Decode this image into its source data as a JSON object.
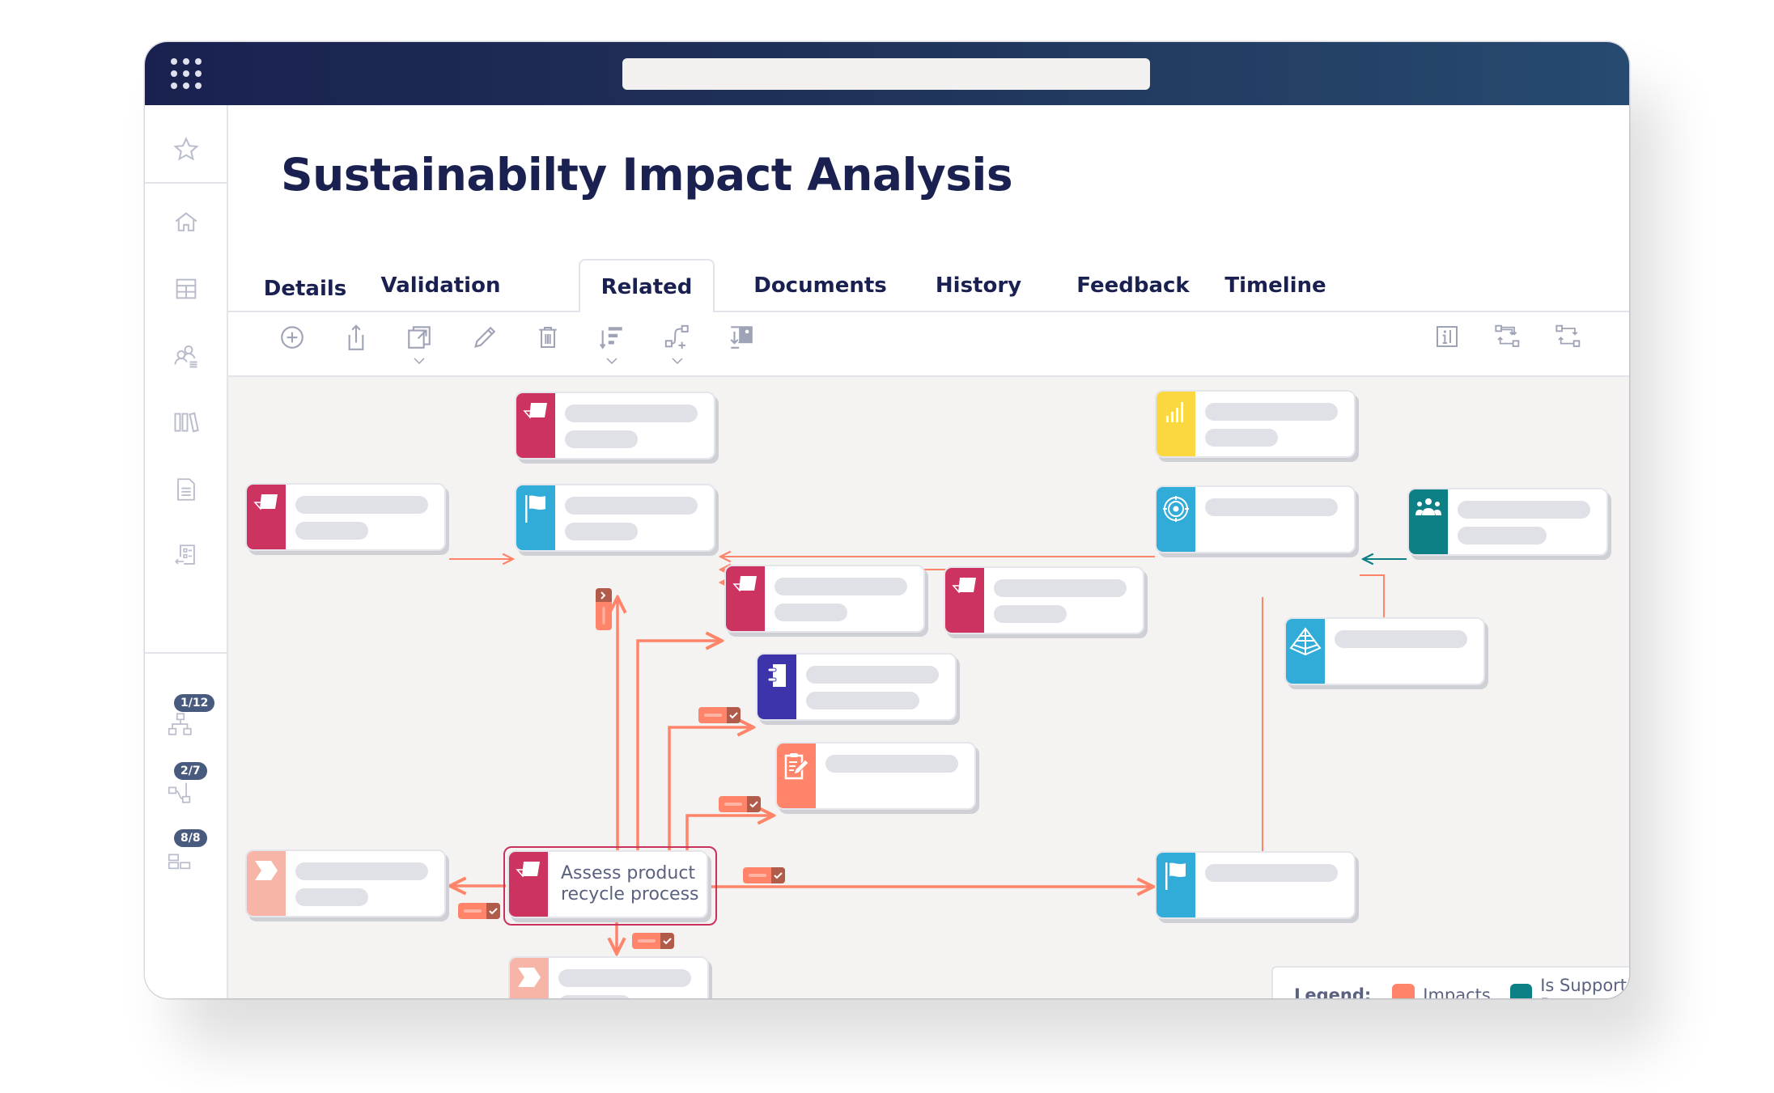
{
  "app": {
    "search": {
      "value": "",
      "placeholder": ""
    }
  },
  "sidebar": {
    "items": [
      {
        "name": "favorites",
        "icon": "star-icon"
      },
      {
        "name": "home",
        "icon": "home-icon"
      },
      {
        "name": "table",
        "icon": "table-icon"
      },
      {
        "name": "users",
        "icon": "users-icon"
      },
      {
        "name": "library",
        "icon": "library-icon"
      },
      {
        "name": "document",
        "icon": "document-icon"
      },
      {
        "name": "checklist",
        "icon": "checklist-icon"
      }
    ],
    "views": [
      {
        "name": "hierarchy-view",
        "icon": "hierarchy-icon",
        "badge": "1/12"
      },
      {
        "name": "flow-view",
        "icon": "flow-icon",
        "badge": "2/7"
      },
      {
        "name": "grid-view",
        "icon": "grid-icon",
        "badge": "8/8"
      }
    ]
  },
  "page": {
    "title": "Sustainabilty Impact Analysis"
  },
  "tabs": [
    {
      "label": "Details",
      "active": false
    },
    {
      "label": "Validation",
      "active": false
    },
    {
      "label": "Related",
      "active": true
    },
    {
      "label": "Documents",
      "active": false
    },
    {
      "label": "History",
      "active": false
    },
    {
      "label": "Feedback",
      "active": false
    },
    {
      "label": "Timeline",
      "active": false
    }
  ],
  "toolbar": {
    "left": [
      "add-icon",
      "export-icon",
      "open-external-icon",
      "edit-icon",
      "delete-icon",
      "sort-icon",
      "connect-icon",
      "download-image-icon"
    ],
    "right": [
      "info-icon",
      "swap-relations-icon",
      "relations-icon"
    ]
  },
  "diagram": {
    "colors": {
      "objective": "#cd3360",
      "milestone": "#31acd8",
      "kpi": "#fcd840",
      "team": "#0d8086",
      "policy": "#3d33ab",
      "assessment": "#ff8469",
      "process": "#f7b5a7",
      "impacts": "#ff8469",
      "supported_by": "#0d8086"
    },
    "nodes": [
      {
        "id": "n1",
        "type": "objective",
        "icon": "objective-icon",
        "label": ""
      },
      {
        "id": "n2",
        "type": "objective",
        "icon": "objective-icon",
        "label": ""
      },
      {
        "id": "n3",
        "type": "milestone",
        "icon": "flag-icon",
        "label": ""
      },
      {
        "id": "n4",
        "type": "objective",
        "icon": "objective-icon",
        "label": ""
      },
      {
        "id": "n5",
        "type": "objective",
        "icon": "objective-icon",
        "label": ""
      },
      {
        "id": "n6",
        "type": "policy",
        "icon": "notebook-icon",
        "label": ""
      },
      {
        "id": "n7",
        "type": "assessment",
        "icon": "clipboard-edit-icon",
        "label": ""
      },
      {
        "id": "n8",
        "type": "objective",
        "icon": "objective-icon",
        "label": "Assess product recycle process",
        "selected": true
      },
      {
        "id": "n9",
        "type": "process",
        "icon": "chevron-process-icon",
        "label": ""
      },
      {
        "id": "n10",
        "type": "process",
        "icon": "chevron-process-icon",
        "label": ""
      },
      {
        "id": "n11",
        "type": "kpi",
        "icon": "signal-bars-icon",
        "label": ""
      },
      {
        "id": "n12",
        "type": "milestone",
        "icon": "target-icon",
        "label": ""
      },
      {
        "id": "n13",
        "type": "team",
        "icon": "team-icon",
        "label": ""
      },
      {
        "id": "n14",
        "type": "milestone",
        "icon": "pyramid-icon",
        "label": ""
      },
      {
        "id": "n15",
        "type": "milestone",
        "icon": "flag-icon",
        "label": ""
      }
    ],
    "edges": [
      {
        "from": "n1",
        "to": "n3",
        "relation": "impacts"
      },
      {
        "from": "n2",
        "to": "n3",
        "relation": "impacts"
      },
      {
        "from": "n12",
        "to": "n3",
        "relation": "impacts"
      },
      {
        "from": "n5",
        "to": "n3",
        "relation": "impacts"
      },
      {
        "from": "n4",
        "to": "n3",
        "relation": "impacts"
      },
      {
        "from": "n11",
        "to": "n12",
        "relation": "supported_by"
      },
      {
        "from": "n13",
        "to": "n12",
        "relation": "supported_by"
      },
      {
        "from": "n12",
        "to": "n14",
        "relation": "impacts"
      },
      {
        "from": "n12",
        "to": "n15",
        "relation": "impacts"
      },
      {
        "from": "n8",
        "to": "n3",
        "relation": "impacts"
      },
      {
        "from": "n8",
        "to": "n4",
        "relation": "impacts"
      },
      {
        "from": "n8",
        "to": "n6",
        "relation": "impacts"
      },
      {
        "from": "n8",
        "to": "n7",
        "relation": "impacts"
      },
      {
        "from": "n8",
        "to": "n9",
        "relation": "impacts"
      },
      {
        "from": "n8",
        "to": "n10",
        "relation": "impacts"
      },
      {
        "from": "n8",
        "to": "n15",
        "relation": "impacts"
      }
    ]
  },
  "legend": {
    "title": "Legend:",
    "items": [
      {
        "label": "Impacts",
        "color": "#ff8469"
      },
      {
        "label": "Is Supported By",
        "color": "#0d8086"
      }
    ]
  }
}
